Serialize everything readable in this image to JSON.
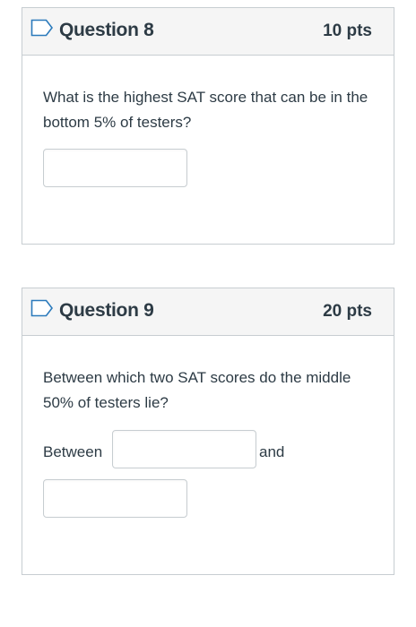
{
  "questions": [
    {
      "title": "Question 8",
      "points": "10 pts",
      "text": "What is the highest SAT score that can be in the bottom 5% of testers?",
      "answer_value": ""
    },
    {
      "title": "Question 9",
      "points": "20 pts",
      "text": "Between which two SAT scores do the middle 50% of testers lie?",
      "between_label": "Between",
      "and_label": "and",
      "answer_value_1": "",
      "answer_value_2": ""
    }
  ],
  "icons": {
    "flag": "bookmark-flag-icon"
  },
  "colors": {
    "border": "#c7cdd1",
    "header_bg": "#f5f5f5",
    "text": "#2d3b45",
    "flag_stroke": "#2b7abc"
  }
}
